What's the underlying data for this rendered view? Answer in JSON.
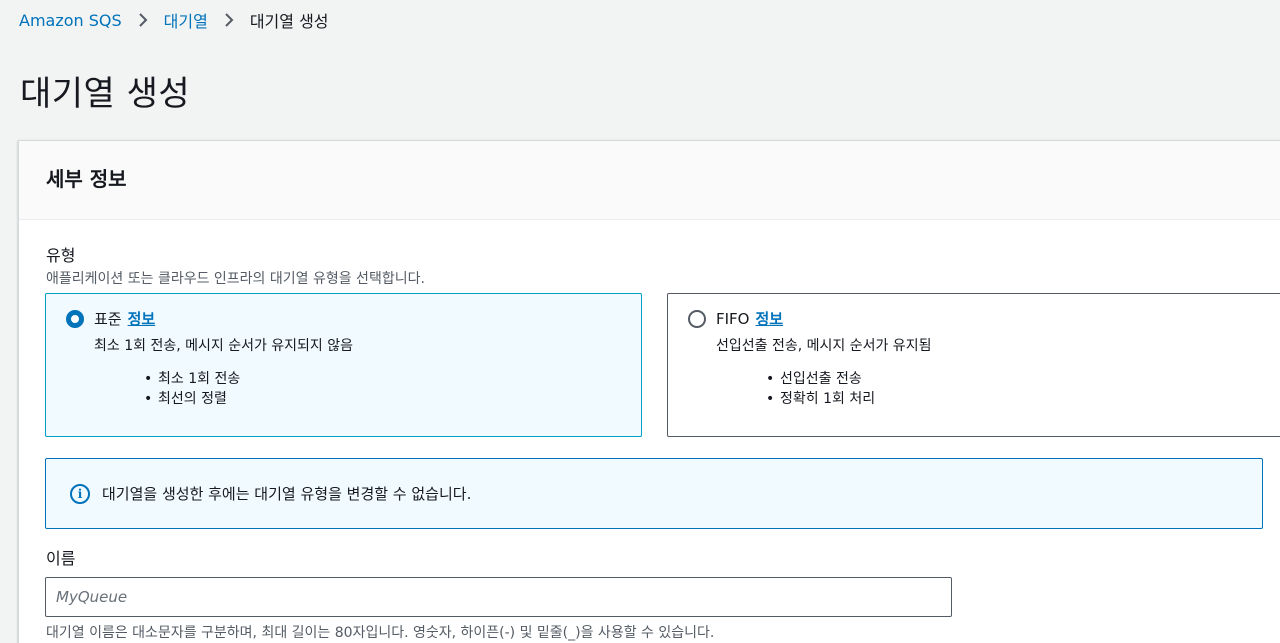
{
  "breadcrumb": {
    "items": [
      "Amazon SQS",
      "대기열"
    ],
    "current": "대기열 생성"
  },
  "page_title": "대기열 생성",
  "panel": {
    "title": "세부 정보",
    "type_field": {
      "label": "유형",
      "description": "애플리케이션 또는 클라우드 인프라의 대기열 유형을 선택합니다.",
      "options": [
        {
          "title": "표준",
          "info": "정보",
          "selected": true,
          "description": "최소 1회 전송, 메시지 순서가 유지되지 않음",
          "bullets": [
            "최소 1회 전송",
            "최선의 정렬"
          ]
        },
        {
          "title": "FIFO",
          "info": "정보",
          "selected": false,
          "description": "선입선출 전송, 메시지 순서가 유지됨",
          "bullets": [
            "선입선출 전송",
            "정확히 1회 처리"
          ]
        }
      ]
    },
    "alert": {
      "icon": "info-icon",
      "text": "대기열을 생성한 후에는 대기열 유형을 변경할 수 없습니다."
    },
    "name_field": {
      "label": "이름",
      "placeholder": "MyQueue",
      "value": "",
      "hint": "대기열 이름은 대소문자를 구분하며, 최대 길이는 80자입니다. 영숫자, 하이픈(-) 및 밑줄(_)을 사용할 수 있습니다."
    }
  },
  "colors": {
    "link": "#0073bb",
    "selected_border": "#00a1c9",
    "selected_bg": "#f1faff",
    "page_bg": "#f2f3f3"
  }
}
